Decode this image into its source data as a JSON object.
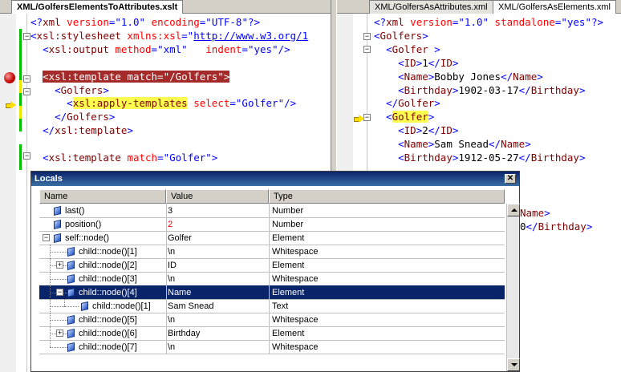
{
  "left_editor": {
    "tab_title": "XML/GolfersElementsToAttributes.xslt",
    "lines": [
      [
        [
          "b",
          "<?"
        ],
        [
          "m",
          "xml "
        ],
        [
          "r",
          "version"
        ],
        [
          "b",
          "=\"1.0\" "
        ],
        [
          "r",
          "encoding"
        ],
        [
          "b",
          "=\"UTF-8\"?>"
        ]
      ],
      [
        [
          "b",
          "<"
        ],
        [
          "m",
          "xsl:stylesheet "
        ],
        [
          "r",
          "xmlns:xsl"
        ],
        [
          "b",
          "=\""
        ],
        [
          "u",
          "http://www.w3.org/1"
        ]
      ],
      [
        [
          "k",
          "  "
        ],
        [
          "b",
          "<"
        ],
        [
          "m",
          "xsl:output "
        ],
        [
          "r",
          "method"
        ],
        [
          "b",
          "=\"xml\"   "
        ],
        [
          "r",
          "indent"
        ],
        [
          "b",
          "=\"yes\"/>"
        ]
      ],
      [
        [
          "k",
          ""
        ]
      ],
      [
        [
          "k",
          "  "
        ],
        [
          "sel",
          "<xsl:template match=\"/Golfers\">"
        ]
      ],
      [
        [
          "k",
          "    "
        ],
        [
          "b",
          "<"
        ],
        [
          "m",
          "Golfers"
        ],
        [
          "b",
          ">"
        ]
      ],
      [
        [
          "k",
          "      "
        ],
        [
          "b",
          "<"
        ],
        [
          "hl",
          "xsl:apply-templates"
        ],
        [
          "k",
          " "
        ],
        [
          "r",
          "select"
        ],
        [
          "b",
          "=\"Golfer\"/>"
        ]
      ],
      [
        [
          "k",
          "    "
        ],
        [
          "b",
          "</"
        ],
        [
          "m",
          "Golfers"
        ],
        [
          "b",
          ">"
        ]
      ],
      [
        [
          "k",
          "  "
        ],
        [
          "b",
          "</"
        ],
        [
          "m",
          "xsl:template"
        ],
        [
          "b",
          ">"
        ]
      ],
      [
        [
          "k",
          ""
        ]
      ],
      [
        [
          "k",
          "  "
        ],
        [
          "b",
          "<"
        ],
        [
          "m",
          "xsl:template "
        ],
        [
          "r",
          "match"
        ],
        [
          "b",
          "=\"Golfer\">"
        ]
      ]
    ]
  },
  "right_editor": {
    "tabs": [
      "XML/GolfersAsAttributes.xml",
      "XML/GolfersAsElements.xml"
    ],
    "lines": [
      [
        [
          "b",
          "<?"
        ],
        [
          "m",
          "xml "
        ],
        [
          "r",
          "version"
        ],
        [
          "b",
          "=\"1.0\" "
        ],
        [
          "r",
          "standalone"
        ],
        [
          "b",
          "=\"yes\"?>"
        ]
      ],
      [
        [
          "b",
          "<"
        ],
        [
          "m",
          "Golfers"
        ],
        [
          "b",
          ">"
        ]
      ],
      [
        [
          "k",
          "  "
        ],
        [
          "b",
          "<"
        ],
        [
          "m",
          "Golfer "
        ],
        [
          "b",
          ">"
        ]
      ],
      [
        [
          "k",
          "    "
        ],
        [
          "b",
          "<"
        ],
        [
          "m",
          "ID"
        ],
        [
          "b",
          ">"
        ],
        [
          "k",
          "1"
        ],
        [
          "b",
          "</"
        ],
        [
          "m",
          "ID"
        ],
        [
          "b",
          ">"
        ]
      ],
      [
        [
          "k",
          "    "
        ],
        [
          "b",
          "<"
        ],
        [
          "m",
          "Name"
        ],
        [
          "b",
          ">"
        ],
        [
          "k",
          "Bobby Jones"
        ],
        [
          "b",
          "</"
        ],
        [
          "m",
          "Name"
        ],
        [
          "b",
          ">"
        ]
      ],
      [
        [
          "k",
          "    "
        ],
        [
          "b",
          "<"
        ],
        [
          "m",
          "Birthday"
        ],
        [
          "b",
          ">"
        ],
        [
          "k",
          "1902-03-17"
        ],
        [
          "b",
          "</"
        ],
        [
          "m",
          "Birthday"
        ],
        [
          "b",
          ">"
        ]
      ],
      [
        [
          "k",
          "  "
        ],
        [
          "b",
          "</"
        ],
        [
          "m",
          "Golfer"
        ],
        [
          "b",
          ">"
        ]
      ],
      [
        [
          "k",
          "  "
        ],
        [
          "b",
          "<"
        ],
        [
          "hl",
          "Golfer"
        ],
        [
          "b",
          ">"
        ]
      ],
      [
        [
          "k",
          "    "
        ],
        [
          "b",
          "<"
        ],
        [
          "m",
          "ID"
        ],
        [
          "b",
          ">"
        ],
        [
          "k",
          "2"
        ],
        [
          "b",
          "</"
        ],
        [
          "m",
          "ID"
        ],
        [
          "b",
          ">"
        ]
      ],
      [
        [
          "k",
          "    "
        ],
        [
          "b",
          "<"
        ],
        [
          "m",
          "Name"
        ],
        [
          "b",
          ">"
        ],
        [
          "k",
          "Sam Snead"
        ],
        [
          "b",
          "</"
        ],
        [
          "m",
          "Name"
        ],
        [
          "b",
          ">"
        ]
      ],
      [
        [
          "k",
          "    "
        ],
        [
          "b",
          "<"
        ],
        [
          "m",
          "Birthday"
        ],
        [
          "b",
          ">"
        ],
        [
          "k",
          "1912-05-27"
        ],
        [
          "b",
          "</"
        ],
        [
          "m",
          "Birthday"
        ],
        [
          "b",
          ">"
        ]
      ]
    ],
    "peek_lines": [
      [
        [
          "m",
          "Name"
        ],
        [
          "b",
          ">"
        ]
      ],
      [
        [
          "k",
          "0"
        ],
        [
          "b",
          "</"
        ],
        [
          "m",
          "Birthday"
        ],
        [
          "b",
          ">"
        ]
      ]
    ]
  },
  "locals": {
    "title": "Locals",
    "close_glyph": "✕",
    "columns": [
      "Name",
      "Value",
      "Type"
    ],
    "rows": [
      {
        "name": "last()",
        "value": "3",
        "type": "Number",
        "value_red": false,
        "depth": 0,
        "expander": "",
        "selected": false
      },
      {
        "name": "position()",
        "value": "2",
        "type": "Number",
        "value_red": true,
        "depth": 0,
        "expander": "",
        "selected": false
      },
      {
        "name": "self::node()",
        "value": "Golfer",
        "type": "Element",
        "value_red": false,
        "depth": 0,
        "expander": "−",
        "selected": false
      },
      {
        "name": "child::node()[1]",
        "value": "\\n",
        "type": "Whitespace",
        "value_red": false,
        "depth": 1,
        "expander": "",
        "selected": false
      },
      {
        "name": "child::node()[2]",
        "value": "ID",
        "type": "Element",
        "value_red": false,
        "depth": 1,
        "expander": "+",
        "selected": false
      },
      {
        "name": "child::node()[3]",
        "value": "\\n",
        "type": "Whitespace",
        "value_red": false,
        "depth": 1,
        "expander": "",
        "selected": false
      },
      {
        "name": "child::node()[4]",
        "value": "Name",
        "type": "Element",
        "value_red": false,
        "depth": 1,
        "expander": "−",
        "selected": true
      },
      {
        "name": "child::node()[1]",
        "value": "Sam Snead",
        "type": "Text",
        "value_red": false,
        "depth": 2,
        "expander": "",
        "selected": false
      },
      {
        "name": "child::node()[5]",
        "value": "\\n",
        "type": "Whitespace",
        "value_red": false,
        "depth": 1,
        "expander": "",
        "selected": false
      },
      {
        "name": "child::node()[6]",
        "value": "Birthday",
        "type": "Element",
        "value_red": false,
        "depth": 1,
        "expander": "+",
        "selected": false
      },
      {
        "name": "child::node()[7]",
        "value": "\\n",
        "type": "Whitespace",
        "value_red": false,
        "depth": 1,
        "expander": "",
        "selected": false
      }
    ]
  },
  "colors": {
    "tag_blue": "#0000ff",
    "name_maroon": "#800000",
    "attr_red": "#ff0000",
    "breakpoint_line_bg": "#a52a2a",
    "current_stmt_highlight": "#ffff50",
    "selection_blue": "#0a246a"
  }
}
